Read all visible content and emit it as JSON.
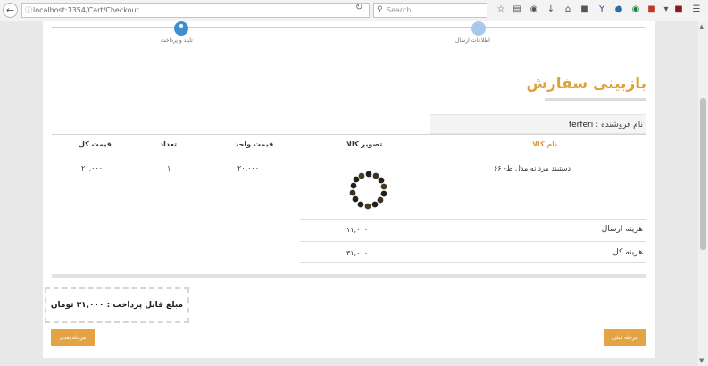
{
  "browser": {
    "url": "localhost:1354/Cart/Checkout",
    "search_placeholder": "Search"
  },
  "steps": [
    {
      "label": "تایید و پرداخت",
      "state": "active",
      "color": "#3d8fd1"
    },
    {
      "label": "اطلاعات ارسال",
      "state": "done",
      "color": "#a9c9ea"
    }
  ],
  "section": {
    "title": "بازبینی سفارش"
  },
  "seller": {
    "label": "نام فروشنده :",
    "name": "ferferi"
  },
  "table": {
    "headers": {
      "product_name": "نام کالا",
      "product_image": "تصویر کالا",
      "unit_price": "قیمت واحد",
      "quantity": "تعداد",
      "total_price": "قیمت کل"
    },
    "rows": [
      {
        "name": "دستبند مردانه مدل ط- ۶۶",
        "unit_price": "۲۰,۰۰۰",
        "quantity": "۱",
        "total_price": "۲۰,۰۰۰"
      }
    ]
  },
  "summary": {
    "shipping_label": "هزینه ارسال",
    "shipping_value": "۱۱,۰۰۰",
    "total_label": "هزینه کل",
    "total_value": "۳۱,۰۰۰"
  },
  "payable": {
    "text": "مبلغ قابل پرداخت : ۳۱,۰۰۰ تومان"
  },
  "buttons": {
    "previous": "مرحله قبلی",
    "next": "مرحله بعدی"
  },
  "colors": {
    "accent": "#e0a139",
    "button": "#e5a444",
    "step_active": "#3d8fd1"
  }
}
